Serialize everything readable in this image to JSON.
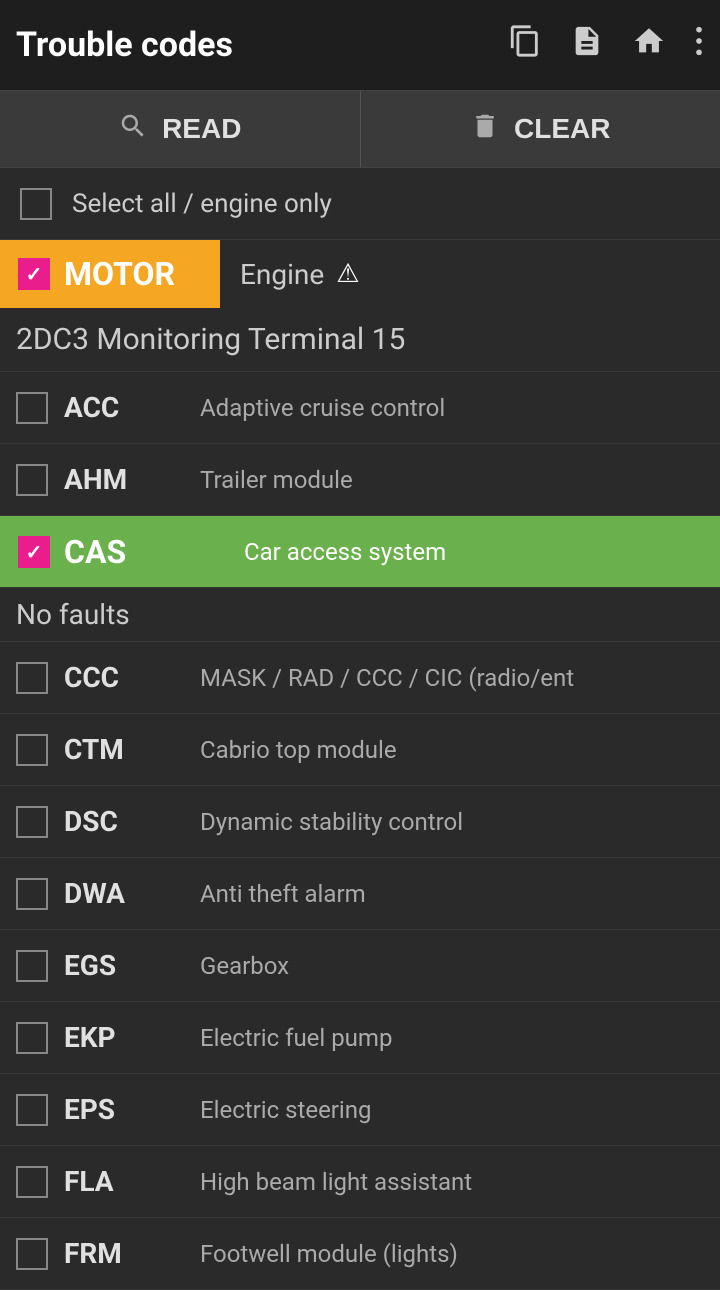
{
  "header": {
    "title": "Trouble codes",
    "icons": [
      "copy",
      "document",
      "home",
      "more"
    ]
  },
  "actions": {
    "read_label": "READ",
    "clear_label": "CLEAR"
  },
  "select_all": {
    "label": "Select all / engine only",
    "checked": false
  },
  "motor": {
    "badge": "MOTOR",
    "engine_label": "Engine",
    "checked": true
  },
  "section_title": "2DC3 Monitoring Terminal 15",
  "no_faults_label": "No faults",
  "modules": [
    {
      "code": "ACC",
      "desc": "Adaptive cruise control",
      "checked": false,
      "selected": false
    },
    {
      "code": "AHM",
      "desc": "Trailer module",
      "checked": false,
      "selected": false
    },
    {
      "code": "CAS",
      "desc": "Car access system",
      "checked": true,
      "selected": true
    },
    {
      "code": "CCC",
      "desc": "MASK / RAD / CCC / CIC (radio/ent",
      "checked": false,
      "selected": false
    },
    {
      "code": "CTM",
      "desc": "Cabrio top module",
      "checked": false,
      "selected": false
    },
    {
      "code": "DSC",
      "desc": "Dynamic stability control",
      "checked": false,
      "selected": false
    },
    {
      "code": "DWA",
      "desc": "Anti theft alarm",
      "checked": false,
      "selected": false
    },
    {
      "code": "EGS",
      "desc": "Gearbox",
      "checked": false,
      "selected": false
    },
    {
      "code": "EKP",
      "desc": "Electric fuel pump",
      "checked": false,
      "selected": false
    },
    {
      "code": "EPS",
      "desc": "Electric steering",
      "checked": false,
      "selected": false
    },
    {
      "code": "FLA",
      "desc": "High beam light assistant",
      "checked": false,
      "selected": false
    },
    {
      "code": "FRM",
      "desc": "Footwell module (lights)",
      "checked": false,
      "selected": false
    }
  ]
}
